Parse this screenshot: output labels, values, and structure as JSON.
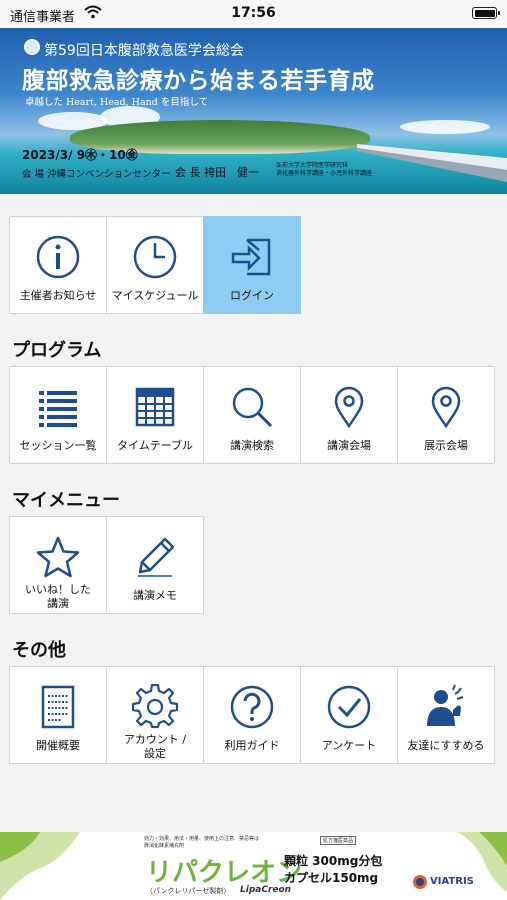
{
  "status_bar": {
    "carrier": "通信事業者",
    "time": "17:56"
  },
  "banner": {
    "society": "第59回日本腹部救急医学会総会",
    "theme": "腹部救急診療から始まる若手育成",
    "subtitle": "卓越した Heart, Head, Hand を目指して",
    "date": "2023/3/ 9㊍・10㊎",
    "venue": "会 場 沖縄コンベンションセンター",
    "chair": "会 長 袴田　健一",
    "affiliation_1": "弘前大学大学院医学研究科",
    "affiliation_2": "消化器外科学講座・小児外科学講座"
  },
  "top_menu": [
    {
      "label": "主催者お知らせ",
      "icon": "info-icon"
    },
    {
      "label": "マイスケジュール",
      "icon": "clock-icon"
    },
    {
      "label": "ログイン",
      "icon": "login-icon"
    }
  ],
  "program": {
    "title": "プログラム",
    "items": [
      {
        "label": "セッション一覧",
        "icon": "list-icon"
      },
      {
        "label": "タイムテーブル",
        "icon": "calendar-icon"
      },
      {
        "label": "講演検索",
        "icon": "search-icon"
      },
      {
        "label": "講演会場",
        "icon": "location-pin-icon"
      },
      {
        "label": "展示会場",
        "icon": "location-pin-icon"
      }
    ]
  },
  "my_menu": {
    "title": "マイメニュー",
    "items": [
      {
        "label_line1": "いいね！した",
        "label_line2": "講演",
        "icon": "star-icon"
      },
      {
        "label": "講演メモ",
        "icon": "pencil-icon"
      }
    ]
  },
  "other": {
    "title": "その他",
    "items": [
      {
        "label": "開催概要",
        "icon": "document-icon"
      },
      {
        "label_line1": "アカウント /",
        "label_line2": "設定",
        "icon": "gear-icon"
      },
      {
        "label": "利用ガイド",
        "icon": "question-icon"
      },
      {
        "label": "アンケート",
        "icon": "checkmark-icon"
      },
      {
        "label": "友達にすすめる",
        "icon": "share-person-icon"
      }
    ]
  },
  "colors": {
    "icon": "#1f4e8c",
    "active_tile": "#8ecdf1",
    "ad_green": "#6db33f"
  },
  "ad": {
    "note_1": "効力・効果、用法・用量、使用上の注意、禁忌等は",
    "note_2": "膵消化酵素補充剤",
    "product": "リパクレオン",
    "dose_1": "顆粒 300mg分包",
    "dose_2": "カプセル150mg",
    "kana": "〈パンクレリパーゼ製剤〉",
    "latin": "LipaCreon",
    "tag": "処方箋医薬品",
    "brand": "VIATRIS"
  }
}
